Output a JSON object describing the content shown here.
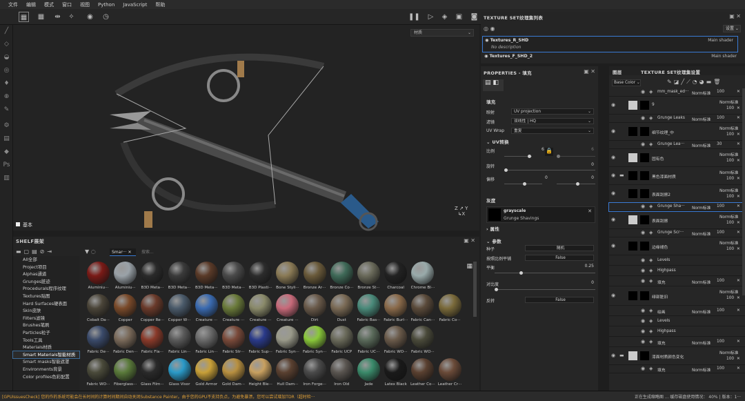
{
  "menu": [
    "文件",
    "编辑",
    "模式",
    "窗口",
    "视图",
    "Python",
    "JavaScript",
    "帮助"
  ],
  "viewport": {
    "dropdown": "材质",
    "label": "基本"
  },
  "texset": {
    "title": "TEXTURE SET纹理集列表",
    "dropdown": "设置",
    "row1_name": "Textures_R_SHD",
    "row1_desc": "No description",
    "row1_shader": "Main shader",
    "row2_name": "Textures_F_SHD_2",
    "row2_shader": "Main shader"
  },
  "props": {
    "title": "PROPERTIES - 填充",
    "fill_header": "填充",
    "projection_label": "映射",
    "projection_value": "UV projection",
    "filter_label": "滤镜",
    "filter_value": "双线性 | HQ",
    "wrap_label": "UV Wrap",
    "wrap_value": "重复",
    "uvtrans_header": "UV转换",
    "scale_label": "比例",
    "scale_v1": "6",
    "scale_v2": "6",
    "rot_label": "旋转",
    "rot_value": "0",
    "offset_label": "偏移",
    "offset_v1": "0",
    "offset_v2": "0",
    "gray_header": "灰度",
    "gray_type": "grayscale",
    "gray_name": "Grunge Shavings",
    "attr_header": "属性",
    "params_header": "参数",
    "seed_label": "种子",
    "seed_value": "随机",
    "ratio_label": "按照比例平铺",
    "ratio_value": "False",
    "balance_label": "平衡",
    "balance_value": "0.25",
    "contrast_label": "对比度",
    "contrast_value": "0",
    "invert_label": "反转",
    "invert_value": "False"
  },
  "layers": {
    "tab1": "图层",
    "tab2": "TEXTURE SET纹理集设置",
    "channel": "Base Color",
    "rows": [
      {
        "name": "mm_mask_ed···",
        "blend": "Norm标准",
        "op": "100"
      },
      {
        "name": "9",
        "blend": "Norm标准",
        "op": "100"
      },
      {
        "name": "Grunge Leaks",
        "blend": "Norm标准",
        "op": "100"
      },
      {
        "name": "细节纹理_中",
        "blend": "Norm标准",
        "op": "100"
      },
      {
        "name": "Grunge Lea···",
        "blend": "Norm标准",
        "op": "30"
      },
      {
        "name": "固有色",
        "blend": "Norm标准",
        "op": "100"
      },
      {
        "name": "黑色漆面材质",
        "blend": "Norm标准",
        "op": "100"
      },
      {
        "name": "表面刮擦2",
        "blend": "Norm标准",
        "op": "100"
      },
      {
        "name": "Grunge Sha···",
        "blend": "Norm标准",
        "op": "100"
      },
      {
        "name": "表面刮擦",
        "blend": "Norm标准",
        "op": "100"
      },
      {
        "name": "Grunge Scr···",
        "blend": "Norm标准",
        "op": "100"
      },
      {
        "name": "边缘褪色",
        "blend": "Norm标准",
        "op": "100"
      },
      {
        "name": "Levels",
        "blend": "",
        "op": ""
      },
      {
        "name": "Highpass",
        "blend": "",
        "op": ""
      },
      {
        "name": "填充",
        "blend": "Norm标准",
        "op": "100"
      },
      {
        "name": "绿部脏旧",
        "blend": "Norm标准",
        "op": "100"
      },
      {
        "name": "绘画",
        "blend": "Norm标准",
        "op": "100"
      },
      {
        "name": "Levels",
        "blend": "",
        "op": ""
      },
      {
        "name": "Highpass",
        "blend": "",
        "op": ""
      },
      {
        "name": "填充",
        "blend": "Norm标准",
        "op": "100"
      },
      {
        "name": "漆面材质颜色变化",
        "blend": "Norm标准",
        "op": "100"
      },
      {
        "name": "填充",
        "blend": "Norm标准",
        "op": "100"
      }
    ]
  },
  "shelf": {
    "title": "SHELF展架",
    "search_tag": "Smar···",
    "search_placeholder": "搜索...",
    "categories": [
      "All全部",
      "Project项目",
      "Alphas通道",
      "Grunges脏迹",
      "Procedurals程序纹理",
      "Textures贴图",
      "Hard Surfaces硬表面",
      "Skin皮肤",
      "Filters滤镜",
      "Brushes笔刷",
      "Particles粒子",
      "Tools工具",
      "Materials材质",
      "Smart Materials智能材质",
      "Smart masks智能遮罩",
      "Environments背景",
      "Color profiles色彩配置"
    ],
    "selected_index": 13,
    "materials": [
      [
        "Aluminiu···",
        "#7a1a16",
        "Aluminiu···",
        "#9aa2a8",
        "B3D Meta···",
        "#2a2a2a",
        "B3D Meta···",
        "#3a3a3a",
        "B3D Meta···",
        "#5a3a28",
        "B3D Meta···",
        "#4a4a4a",
        "B3D Plasti···",
        "#2c2c2c",
        "Bone Styli···",
        "#8a7a55",
        "Bronze Ar···",
        "#6a5a3a",
        "Bronze Co···",
        "#3f6a58",
        "Bronze St···",
        "#6a6a5a",
        "Charcoal",
        "#222",
        "Chrome Bl···",
        "#9aa"
      ],
      [
        "Cobalt Da···",
        "#4a4438",
        "Copper",
        "#7a4a2a",
        "Copper Re···",
        "#6a3a2a",
        "Copper W···",
        "#4a5a6a",
        "Creature ···",
        "#3a6ab0",
        "Creature ···",
        "#6a7a3a",
        "Creature ···",
        "#8a8a6a",
        "Creature ···",
        "#c86a7a",
        "Dirt",
        "#6a5a4a",
        "Dust",
        "#7a6a55",
        "Fabric Bas···",
        "#4a8a7a",
        "Fabric Burl···",
        "#8a6a4a",
        "Fabric Can···",
        "#5a4a3a",
        "Fabric Co···",
        "#7a6a3a"
      ],
      [
        "Fabric De···",
        "#3a4a6a",
        "Fabric Den···",
        "#7a6a5a",
        "Fabric Fla···",
        "#8a3a2a",
        "Fabric Lin···",
        "#5a5a5a",
        "Fabric Lin···",
        "#6a6a6a",
        "Fabric Str···",
        "#7a4a3a",
        "Fabric Sup···",
        "#2a3a8a",
        "Fabric Syn···",
        "#9a9a8a",
        "Fabric Syn···",
        "#8ac83a",
        "Fabric UCP",
        "#6a6a5a",
        "Fabric UC···",
        "#5a6a5a",
        "Fabric WO···",
        "#6a5a4a",
        "Fabric WO···",
        "#4a4a3a"
      ],
      [
        "Fabric WO···",
        "#4a4a3a",
        "Fiberglass···",
        "#5a7a3a",
        "Glass Film···",
        "#2a2a2a",
        "Glass Visor",
        "#2a9ac8",
        "Gold Armor",
        "#c8a038",
        "Gold Dam···",
        "#b89040",
        "Height Ble···",
        "#c8a060",
        "Hull Dam···",
        "#5a4030",
        "Iron Forge···",
        "#4a4a4a",
        "Iron Old",
        "#5a5550",
        "Jade",
        "#3a8a6a",
        "Latex Black",
        "#1a1a1a",
        "Leather Co···",
        "#5a4030",
        "Leather Cr···",
        "#6a4a38"
      ]
    ]
  },
  "status": {
    "left": "[GPUIssuesCheck] 您的作的系统可能会在长时间的计算时间期间自动关闭Substance Painter。由于您的GPU不支持负点，为避免暴溃，您可以尝试增加TDR（超时检···",
    "right": "正在生成缩略图 ...    缓存磁盘使用情况：  40%  |  版本：1···"
  },
  "colors": {
    "accent": "#3a7bd5",
    "warn": "#e0a038"
  }
}
